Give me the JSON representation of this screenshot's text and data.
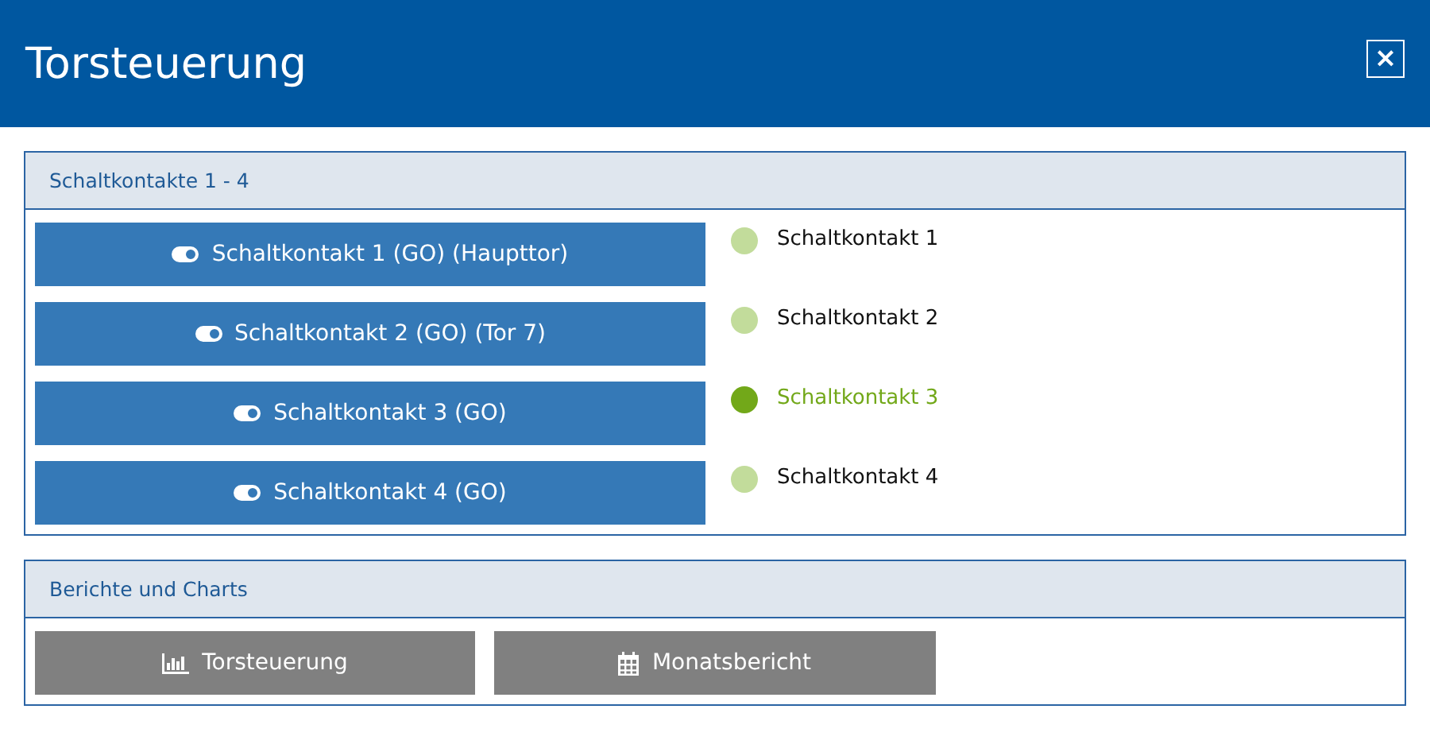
{
  "window": {
    "title": "Torsteuerung",
    "close": "×"
  },
  "contacts_panel": {
    "title": "Schaltkontakte 1 - 4",
    "buttons": [
      {
        "label": "Schaltkontakt 1 (GO) (Haupttor)"
      },
      {
        "label": "Schaltkontakt 2 (GO) (Tor 7)"
      },
      {
        "label": "Schaltkontakt 3 (GO)"
      },
      {
        "label": "Schaltkontakt 4 (GO)"
      }
    ],
    "statuses": [
      {
        "label": "Schaltkontakt 1",
        "on": false
      },
      {
        "label": "Schaltkontakt 2",
        "on": false
      },
      {
        "label": "Schaltkontakt 3",
        "on": true
      },
      {
        "label": "Schaltkontakt 4",
        "on": false
      }
    ]
  },
  "reports_panel": {
    "title": "Berichte und Charts",
    "buttons": [
      {
        "label": "Torsteuerung",
        "kind": "chart"
      },
      {
        "label": "Monatsbericht",
        "kind": "calendar"
      }
    ]
  }
}
